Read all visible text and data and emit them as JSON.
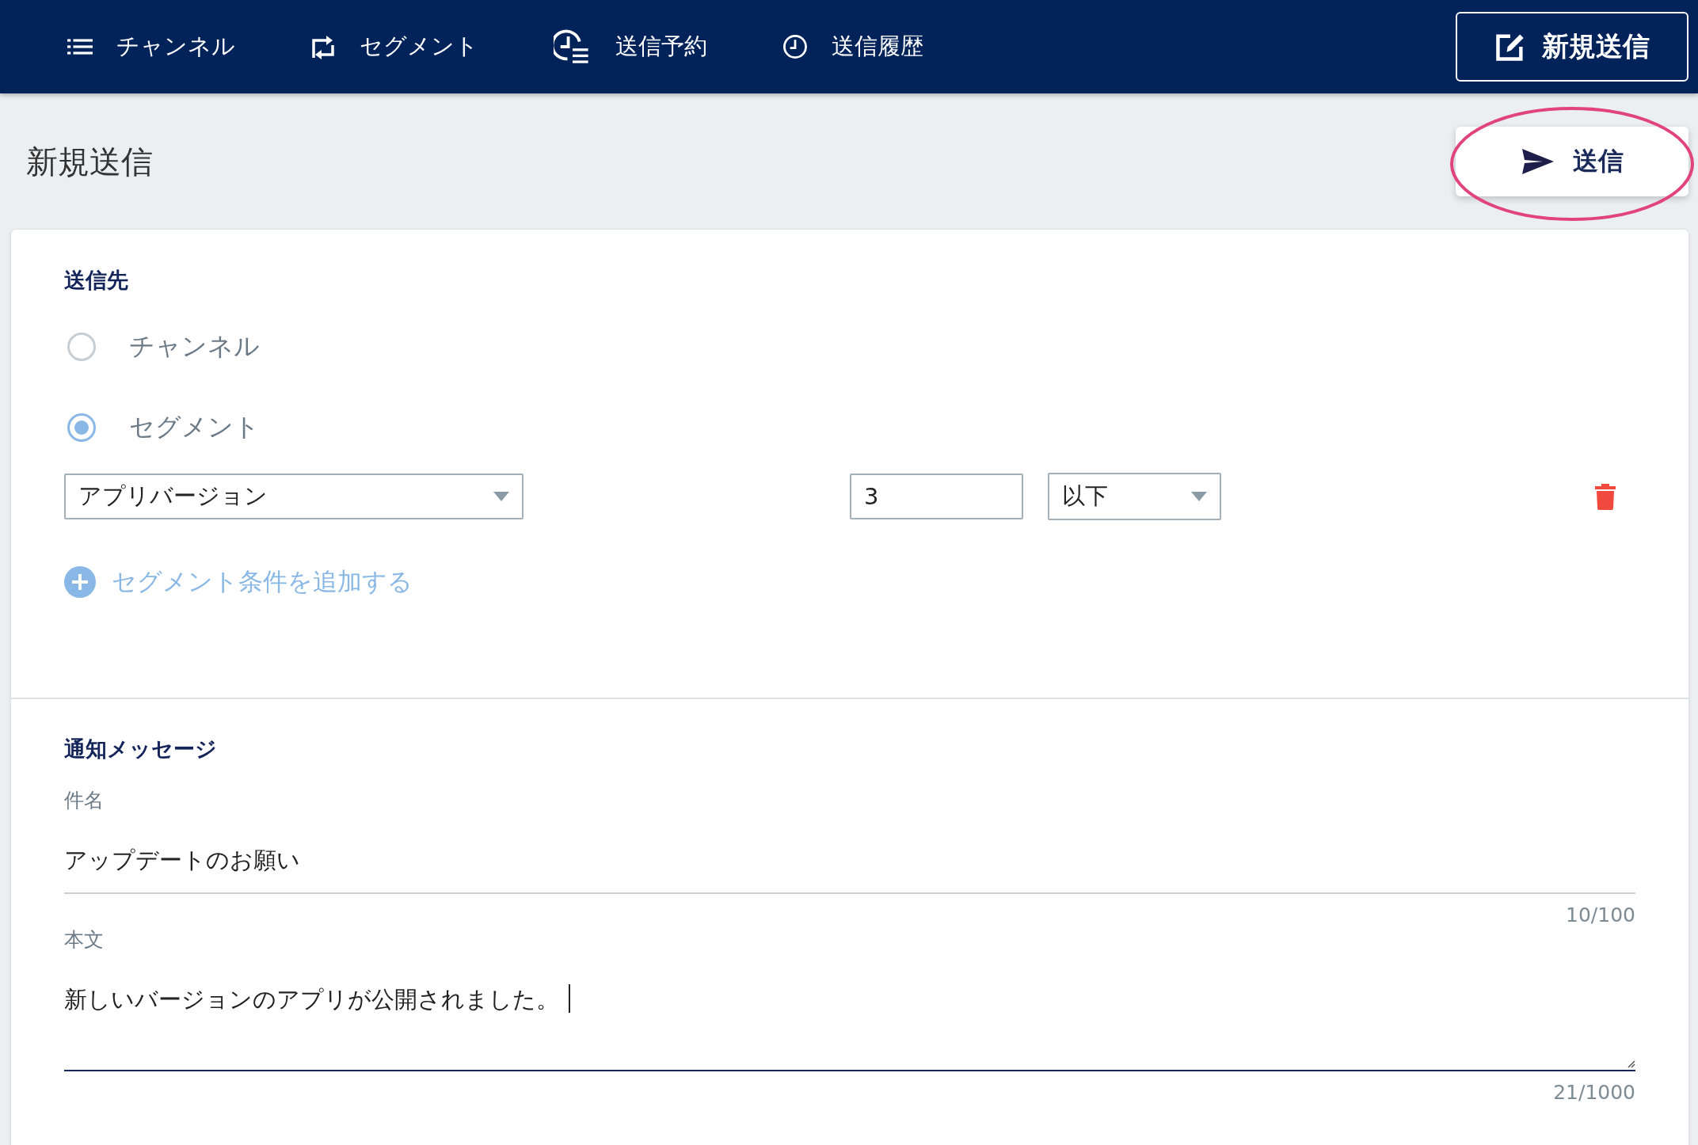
{
  "nav": {
    "items": [
      {
        "label": "チャンネル",
        "kind": "list"
      },
      {
        "label": "セグメント",
        "kind": "segment"
      },
      {
        "label": "送信予約",
        "kind": "schedule"
      },
      {
        "label": "送信履歴",
        "kind": "history"
      }
    ],
    "new_button": "新規送信"
  },
  "page": {
    "title": "新規送信",
    "send_button": "送信"
  },
  "recipient": {
    "heading": "送信先",
    "options": [
      {
        "label": "チャンネル",
        "selected": false
      },
      {
        "label": "セグメント",
        "selected": true
      }
    ],
    "condition": {
      "attribute": "アプリバージョン",
      "value": "3",
      "operator": "以下"
    },
    "add_label": "セグメント条件を追加する"
  },
  "message": {
    "heading": "通知メッセージ",
    "subject": {
      "label": "件名",
      "value": "アップデートのお願い",
      "counter": "10/100",
      "focused": false
    },
    "body": {
      "label": "本文",
      "value": "新しいバージョンのアプリが公開されました。",
      "counter": "21/1000",
      "focused": true
    }
  }
}
